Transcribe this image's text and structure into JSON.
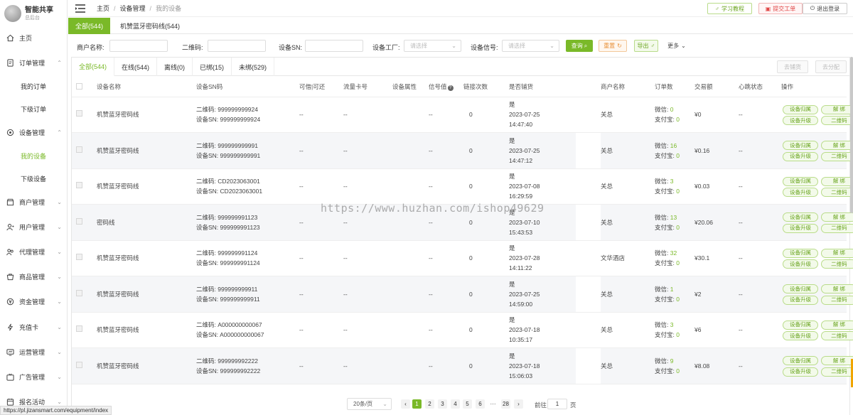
{
  "brand": {
    "name": "智能共享",
    "sub": "总后台"
  },
  "sidebar": {
    "items": [
      {
        "label": "主页",
        "icon": "home-icon"
      },
      {
        "label": "订单管理",
        "icon": "order-icon"
      },
      {
        "label": "我的订单"
      },
      {
        "label": "下级订单"
      },
      {
        "label": "设备管理",
        "icon": "device-icon"
      },
      {
        "label": "我的设备"
      },
      {
        "label": "下级设备"
      },
      {
        "label": "商户管理",
        "icon": "shop-icon"
      },
      {
        "label": "用户管理",
        "icon": "user-icon"
      },
      {
        "label": "代理管理",
        "icon": "agent-icon"
      },
      {
        "label": "商品管理",
        "icon": "goods-icon"
      },
      {
        "label": "资金管理",
        "icon": "fund-icon"
      },
      {
        "label": "充值卡",
        "icon": "card-icon"
      },
      {
        "label": "运营管理",
        "icon": "ops-icon"
      },
      {
        "label": "广告管理",
        "icon": "ad-icon"
      },
      {
        "label": "报名活动",
        "icon": "event-icon"
      }
    ]
  },
  "header": {
    "breadcrumb": [
      "主页",
      "设备管理",
      "我的设备"
    ],
    "btn_tutorial": "学习教程",
    "btn_ticket": "提交工单",
    "btn_logout": "退出登录"
  },
  "page_tabs": [
    "全部(544)",
    "机赞蓝牙密码线(544)"
  ],
  "filter": {
    "merchant_label": "商户名称:",
    "qrcode_label": "二维码:",
    "sn_label": "设备SN:",
    "factory_label": "设备工厂:",
    "factory_placeholder": "请选择",
    "signal_label": "设备信号:",
    "signal_placeholder": "请选择",
    "search": "查询",
    "reset": "重置",
    "export": "导出",
    "more": "更多"
  },
  "sub_tabs": [
    "全部(544)",
    "在线(544)",
    "离线(0)",
    "已绑(15)",
    "未绑(529)"
  ],
  "toolbar": {
    "btn_bind": "去铺货",
    "btn_assign": "去分配"
  },
  "table": {
    "headers": [
      "设备名称",
      "设备SN码",
      "可借|可还",
      "流量卡号",
      "设备属性",
      "信号值",
      "链接次数",
      "是否铺货",
      "商户名称",
      "订单数",
      "交易额",
      "心跳状态",
      "操作"
    ],
    "qr_prefix": "二维码:",
    "sn_prefix": "设备SN:",
    "wx_prefix": "微信:",
    "ali_prefix": "支付宝:",
    "ops": [
      "设备归属",
      "解 绑",
      "设备升级",
      "二维码"
    ],
    "rows": [
      {
        "name": "机赞蓝牙密码线",
        "qr": "999999999924",
        "sn": "999999999924",
        "borrow": "--",
        "card": "--",
        "attr": "",
        "signal": "--",
        "links": "0",
        "placed": "是",
        "date": "2023-07-25",
        "time": "14:47:40",
        "merchant": "关总",
        "wx": "0",
        "ali": "0",
        "amount": "¥0",
        "heart": "--"
      },
      {
        "name": "机赞蓝牙密码线",
        "qr": "999999999991",
        "sn": "999999999991",
        "borrow": "--",
        "card": "--",
        "attr": "",
        "signal": "--",
        "links": "0",
        "placed": "是",
        "date": "2023-07-25",
        "time": "14:47:12",
        "merchant": "关总",
        "wx": "16",
        "ali": "0",
        "amount": "¥0.16",
        "heart": "--"
      },
      {
        "name": "机赞蓝牙密码线",
        "qr": "CD2023063001",
        "sn": "CD2023063001",
        "borrow": "--",
        "card": "--",
        "attr": "",
        "signal": "--",
        "links": "0",
        "placed": "是",
        "date": "2023-07-08",
        "time": "16:29:59",
        "merchant": "关总",
        "wx": "3",
        "ali": "0",
        "amount": "¥0.03",
        "heart": "--"
      },
      {
        "name": "密码线",
        "qr": "999999991123",
        "sn": "999999991123",
        "borrow": "--",
        "card": "--",
        "attr": "",
        "signal": "--",
        "links": "0",
        "placed": "是",
        "date": "2023-07-10",
        "time": "15:43:53",
        "merchant": "关总",
        "wx": "13",
        "ali": "0",
        "amount": "¥20.06",
        "heart": "--"
      },
      {
        "name": "机赞蓝牙密码线",
        "qr": "999999991124",
        "sn": "999999991124",
        "borrow": "--",
        "card": "--",
        "attr": "",
        "signal": "--",
        "links": "0",
        "placed": "是",
        "date": "2023-07-28",
        "time": "14:11:22",
        "merchant": "文华酒店",
        "wx": "32",
        "ali": "0",
        "amount": "¥30.1",
        "heart": "--"
      },
      {
        "name": "机赞蓝牙密码线",
        "qr": "999999999911",
        "sn": "999999999911",
        "borrow": "--",
        "card": "--",
        "attr": "",
        "signal": "--",
        "links": "0",
        "placed": "是",
        "date": "2023-07-25",
        "time": "14:59:00",
        "merchant": "关总",
        "wx": "1",
        "ali": "0",
        "amount": "¥2",
        "heart": "--"
      },
      {
        "name": "机赞蓝牙密码线",
        "qr": "A000000000067",
        "sn": "A000000000067",
        "borrow": "--",
        "card": "--",
        "attr": "",
        "signal": "--",
        "links": "0",
        "placed": "是",
        "date": "2023-07-18",
        "time": "10:35:17",
        "merchant": "关总",
        "wx": "3",
        "ali": "0",
        "amount": "¥6",
        "heart": "--"
      },
      {
        "name": "机赞蓝牙密码线",
        "qr": "999999992222",
        "sn": "999999992222",
        "borrow": "--",
        "card": "--",
        "attr": "",
        "signal": "--",
        "links": "0",
        "placed": "是",
        "date": "2023-07-18",
        "time": "15:06:03",
        "merchant": "关总",
        "wx": "9",
        "ali": "0",
        "amount": "¥8.08",
        "heart": "--"
      }
    ]
  },
  "pager": {
    "page_size": "20条/页",
    "pages": [
      "1",
      "2",
      "3",
      "4",
      "5",
      "6",
      "···",
      "28"
    ],
    "goto_label": "前往",
    "goto_value": "1",
    "page_unit": "页"
  },
  "status_url": "https://pl.jizansmart.com/equipment/index",
  "watermark": "https://www.huzhan.com/ishop49629",
  "colors": {
    "accent": "#7ab928",
    "danger": "#e04646"
  }
}
